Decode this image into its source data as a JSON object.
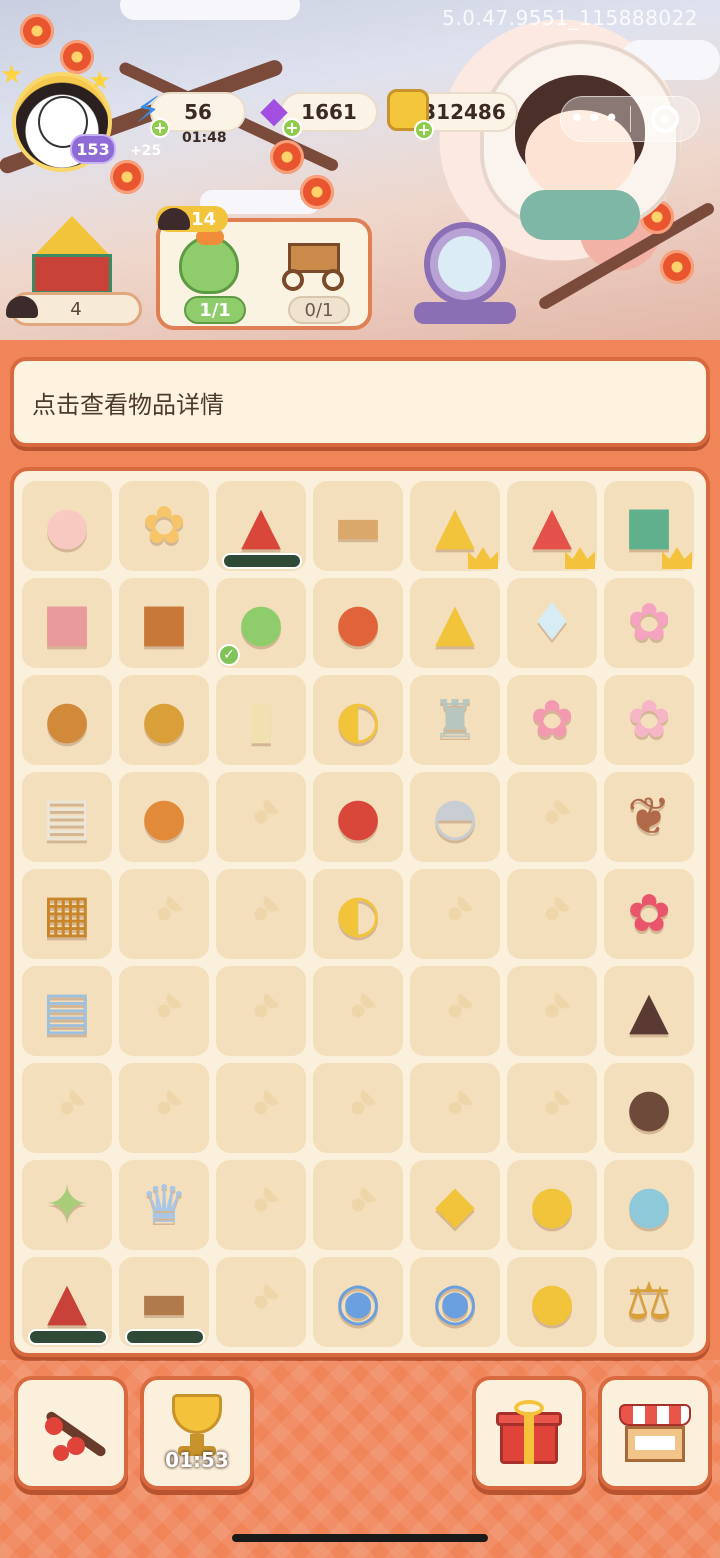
{
  "version_text": "5.0.47.9551_115888022",
  "player": {
    "level": "153",
    "avatar_icon": "princess-avatar"
  },
  "resources": {
    "energy": {
      "value": "56",
      "timer": "01:48",
      "bonus": "+25",
      "icon": "lightning-icon"
    },
    "gems": {
      "value": "1661",
      "icon": "gem-icon"
    },
    "coins": {
      "value": "312486",
      "icon": "coin-icon"
    }
  },
  "menu": {
    "more_icon": "more-dots-icon",
    "close_icon": "target-icon"
  },
  "house": {
    "count": "4"
  },
  "order": {
    "badge": "14",
    "items": [
      {
        "name": "pouch",
        "progress": "1/1"
      },
      {
        "name": "cart",
        "progress": "0/1"
      }
    ]
  },
  "info_bar": {
    "text": "点击查看物品详情"
  },
  "board": {
    "rows": [
      [
        "girl-at-desk",
        "flower-pile",
        "red-palanquin",
        "low-table",
        "gold-pavilion",
        "palace-gate",
        "green-shop"
      ],
      [
        "pink-cushion",
        "treasure-chest",
        "green-pouch",
        "lute",
        "gold-roof",
        "vase",
        "bonsai-tree"
      ],
      [
        "teapot",
        "incense-burner",
        "jade-tag",
        "fan",
        "lantern",
        "pink-flower",
        "plum-branch"
      ],
      [
        "paper-scroll",
        "gourd-cup",
        "",
        "drum",
        "bell",
        "",
        "twig"
      ],
      [
        "game-board",
        "",
        "",
        "folding-fan",
        "",
        "",
        "peony-pot"
      ],
      [
        "book-stack",
        "",
        "",
        "",
        "",
        "",
        "soil-pile"
      ],
      [
        "",
        "",
        "",
        "",
        "",
        "",
        "chestnut-bowl"
      ],
      [
        "hairpins",
        "silver-crown",
        "",
        "",
        "purple-pouch",
        "gold-coins-2",
        "herb-bowl"
      ],
      [
        "red-hall",
        "study-desk",
        "",
        "film-reels",
        "film-box",
        "gold-coins-stack",
        "balance-scale"
      ]
    ]
  },
  "buttons": {
    "plum_branch": {
      "icon": "plum-branch-icon"
    },
    "trophy": {
      "icon": "trophy-icon",
      "timer": "01:53"
    },
    "gift": {
      "icon": "gift-icon"
    },
    "shop": {
      "icon": "shop-icon"
    }
  },
  "colors": {
    "background": "#f0855a",
    "panel": "#fbf0dc",
    "border": "#d96a3f",
    "cell": "#f3dfbb"
  }
}
